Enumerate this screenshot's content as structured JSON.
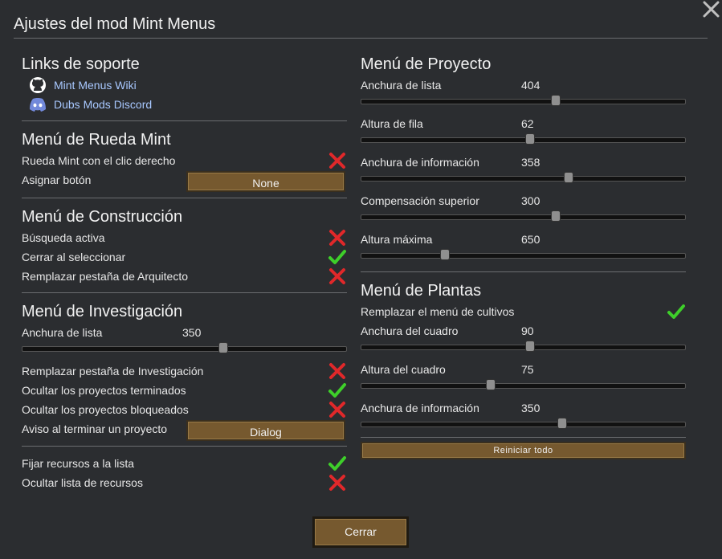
{
  "window": {
    "title": "Ajustes del mod Mint Menus"
  },
  "support": {
    "title": "Links de soporte",
    "links": [
      {
        "label": "Mint Menus Wiki",
        "icon": "github-icon"
      },
      {
        "label": "Dubs Mods Discord",
        "icon": "discord-icon"
      }
    ]
  },
  "wheel": {
    "title": "Menú de Rueda Mint",
    "right_click_label": "Rueda Mint con el clic derecho",
    "right_click_on": false,
    "assign_label": "Asignar botón",
    "assign_value": "None"
  },
  "build": {
    "title": "Menú de Construcción",
    "active_search_label": "Búsqueda activa",
    "active_search_on": false,
    "close_select_label": "Cerrar al seleccionar",
    "close_select_on": true,
    "replace_arch_label": "Remplazar pestaña de Arquitecto",
    "replace_arch_on": false
  },
  "research": {
    "title": "Menú de Investigación",
    "list_width_label": "Anchura de lista",
    "list_width_value": "350",
    "list_width_fraction": 0.62,
    "replace_tab_label": "Remplazar pestaña de Investigación",
    "replace_tab_on": false,
    "hide_finished_label": "Ocultar los proyectos terminados",
    "hide_finished_on": true,
    "hide_locked_label": "Ocultar los proyectos bloqueados",
    "hide_locked_on": false,
    "notify_label": "Aviso al terminar un proyecto",
    "notify_value": "Dialog",
    "pin_resources_label": "Fijar recursos a la lista",
    "pin_resources_on": true,
    "hide_resources_label": "Ocultar lista de recursos",
    "hide_resources_on": false
  },
  "project": {
    "title": "Menú de Proyecto",
    "sliders": [
      {
        "label": "Anchura de lista",
        "value": "404",
        "fraction": 0.6
      },
      {
        "label": "Altura de fila",
        "value": "62",
        "fraction": 0.52
      },
      {
        "label": "Anchura de información",
        "value": "358",
        "fraction": 0.64
      },
      {
        "label": "Compensación superior",
        "value": "300",
        "fraction": 0.6
      },
      {
        "label": "Altura máxima",
        "value": "650",
        "fraction": 0.26
      }
    ]
  },
  "plants": {
    "title": "Menú de Plantas",
    "replace_label": "Remplazar el menú de cultivos",
    "replace_on": true,
    "sliders": [
      {
        "label": "Anchura del cuadro",
        "value": "90",
        "fraction": 0.52
      },
      {
        "label": "Altura del cuadro",
        "value": "75",
        "fraction": 0.4
      },
      {
        "label": "Anchura de información",
        "value": "350",
        "fraction": 0.62
      }
    ]
  },
  "reset_label": "Reiniciar todo",
  "close_label": "Cerrar",
  "colors": {
    "check_on": "#3ecf2a",
    "check_off": "#e0282a",
    "button": "#76592f",
    "link": "#a8c8ff"
  }
}
